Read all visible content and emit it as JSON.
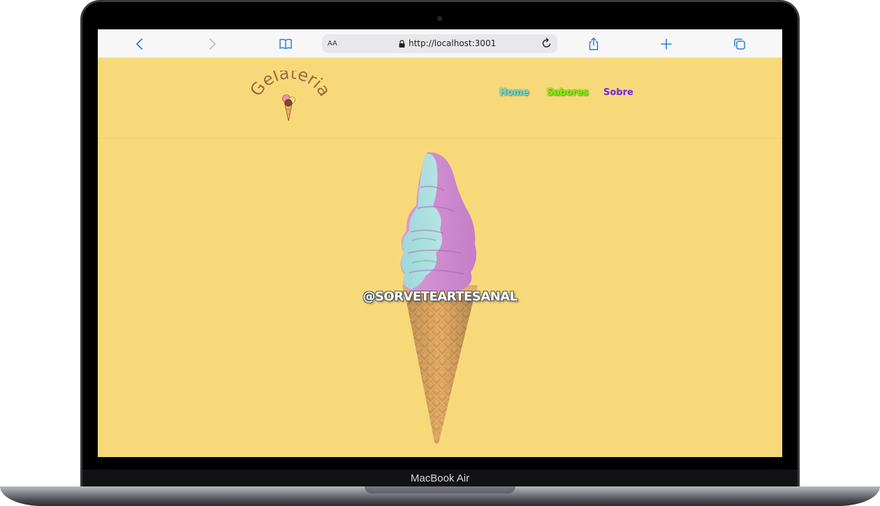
{
  "device": {
    "label": "MacBook Air"
  },
  "browser": {
    "text_size_label": "AA",
    "url": "http://localhost:3001",
    "icons": [
      "back-icon",
      "forward-icon",
      "bookmarks-icon",
      "lock-icon",
      "reload-icon",
      "share-icon",
      "new-tab-icon",
      "tabs-icon"
    ]
  },
  "site": {
    "logo_text": "Gelateria",
    "nav": {
      "home": "Home",
      "sabores": "Sabores",
      "sobre": "Sobre"
    },
    "hero": {
      "handle": "@SORVETEARTESANAL"
    },
    "colors": {
      "background": "#f8d97a",
      "logo": "#9a6a40",
      "nav_home": "#6fdbd3",
      "nav_sabores": "#7ef400",
      "nav_sobre": "#7a2bd6"
    }
  }
}
